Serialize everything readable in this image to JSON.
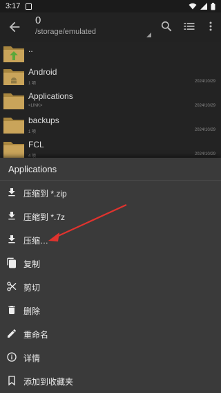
{
  "status_bar": {
    "time": "3:17"
  },
  "app_bar": {
    "count": "0",
    "path": "/storage/emulated"
  },
  "files": [
    {
      "name": "..",
      "meta": "",
      "date": ""
    },
    {
      "name": "Android",
      "meta": "1 项",
      "date": "2024/10/29"
    },
    {
      "name": "Applications",
      "meta": "<LINK>",
      "date": "2024/10/29"
    },
    {
      "name": "backups",
      "meta": "1 项",
      "date": "2024/10/29"
    },
    {
      "name": "FCL",
      "meta": "4 项",
      "date": "2024/10/29"
    }
  ],
  "sheet": {
    "title": "Applications",
    "items": [
      {
        "label": "压缩到 *.zip",
        "icon": "download-icon"
      },
      {
        "label": "压缩到 *.7z",
        "icon": "download-icon"
      },
      {
        "label": "压缩…",
        "icon": "download-icon"
      },
      {
        "label": "复制",
        "icon": "copy-icon"
      },
      {
        "label": "剪切",
        "icon": "scissors-icon"
      },
      {
        "label": "删除",
        "icon": "trash-icon"
      },
      {
        "label": "重命名",
        "icon": "pencil-icon"
      },
      {
        "label": "详情",
        "icon": "info-icon"
      },
      {
        "label": "添加到收藏夹",
        "icon": "bookmark-icon"
      }
    ]
  },
  "colors": {
    "folder": "#c9a45a",
    "folder_dark": "#a8863f",
    "accent_arrow": "#e0332e",
    "sheet_bg": "#3a3a3a"
  }
}
